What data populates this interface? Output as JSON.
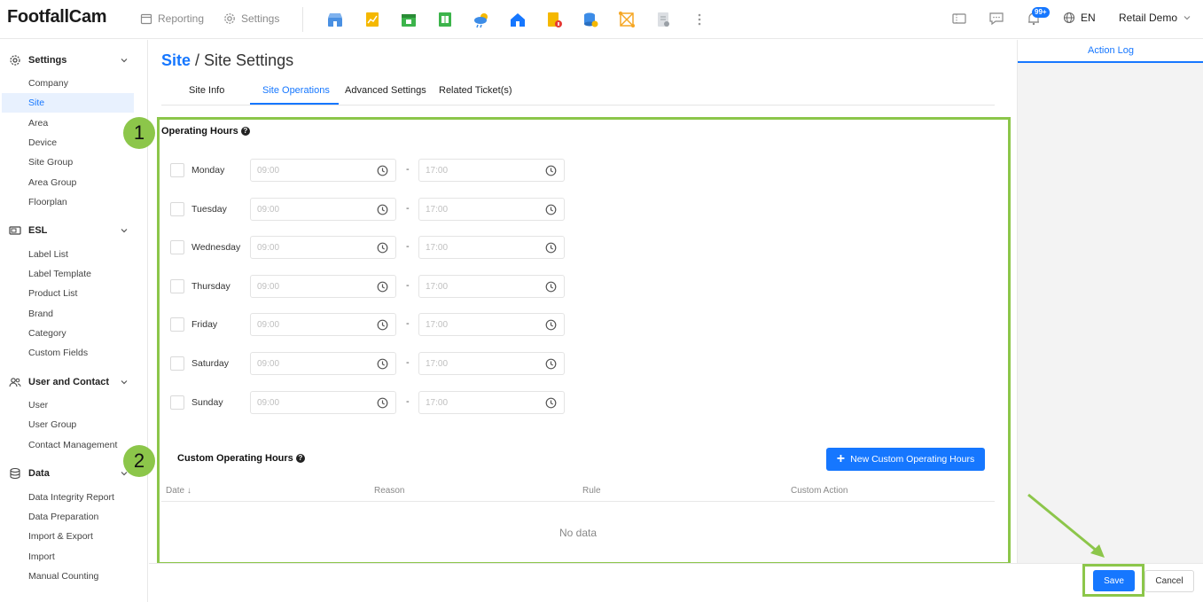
{
  "header": {
    "logo": "FootfallCam",
    "nav": [
      {
        "label": "Reporting",
        "icon": "calendar-icon"
      },
      {
        "label": "Settings",
        "icon": "gear-icon"
      }
    ],
    "apps": [
      {
        "icon": "store-icon",
        "color": "#4a90e2"
      },
      {
        "icon": "chart-note-icon",
        "color": "#f5b800"
      },
      {
        "icon": "calendar-green-icon",
        "color": "#3cb44b"
      },
      {
        "icon": "spreadsheet-icon",
        "color": "#3cb44b"
      },
      {
        "icon": "weather-icon",
        "color": "#3c8ce7"
      },
      {
        "icon": "home-icon",
        "color": "#1677ff"
      },
      {
        "icon": "file-alert-icon",
        "color": "#f5a623"
      },
      {
        "icon": "database-icon",
        "color": "#3c8ce7"
      },
      {
        "icon": "network-icon",
        "color": "#f5a623"
      },
      {
        "icon": "document-icon",
        "color": "#9aa0a6"
      }
    ],
    "notification_badge": "99+",
    "language": "EN",
    "account": "Retail Demo"
  },
  "sidebar": {
    "groups": [
      {
        "label": "Settings",
        "icon": "gear-icon",
        "items": [
          "Company",
          "Site",
          "Area",
          "Device",
          "Site Group",
          "Area Group",
          "Floorplan"
        ]
      },
      {
        "label": "ESL",
        "icon": "label-icon",
        "items": [
          "Label List",
          "Label Template",
          "Product List",
          "Brand",
          "Category",
          "Custom Fields"
        ]
      },
      {
        "label": "User and Contact",
        "icon": "users-icon",
        "items": [
          "User",
          "User Group",
          "Contact Management"
        ]
      },
      {
        "label": "Data",
        "icon": "database-icon",
        "items": [
          "Data Integrity Report",
          "Data Preparation",
          "Import & Export",
          "Import",
          "Manual Counting"
        ]
      }
    ],
    "active_item": "Site"
  },
  "page": {
    "breadcrumb_root": "Site",
    "breadcrumb_sep": " / ",
    "title": "Site Settings",
    "tabs": [
      "Site Info",
      "Site Operations",
      "Advanced Settings",
      "Related Ticket(s)"
    ],
    "active_tab": "Site Operations"
  },
  "operating_hours": {
    "title": "Operating Hours",
    "separator": "-",
    "days": [
      {
        "day": "Monday",
        "start": "09:00",
        "end": "17:00"
      },
      {
        "day": "Tuesday",
        "start": "09:00",
        "end": "17:00"
      },
      {
        "day": "Wednesday",
        "start": "09:00",
        "end": "17:00"
      },
      {
        "day": "Thursday",
        "start": "09:00",
        "end": "17:00"
      },
      {
        "day": "Friday",
        "start": "09:00",
        "end": "17:00"
      },
      {
        "day": "Saturday",
        "start": "09:00",
        "end": "17:00"
      },
      {
        "day": "Sunday",
        "start": "09:00",
        "end": "17:00"
      }
    ]
  },
  "custom_hours": {
    "title": "Custom Operating Hours",
    "new_button": "New Custom Operating Hours",
    "columns": [
      "Date",
      "Reason",
      "Rule",
      "Custom Action"
    ],
    "empty_text": "No data"
  },
  "right_panel": {
    "tab": "Action Log"
  },
  "footer": {
    "save": "Save",
    "cancel": "Cancel"
  },
  "annotations": {
    "step1": "1",
    "step2": "2",
    "highlight_color": "#8cc64a"
  }
}
